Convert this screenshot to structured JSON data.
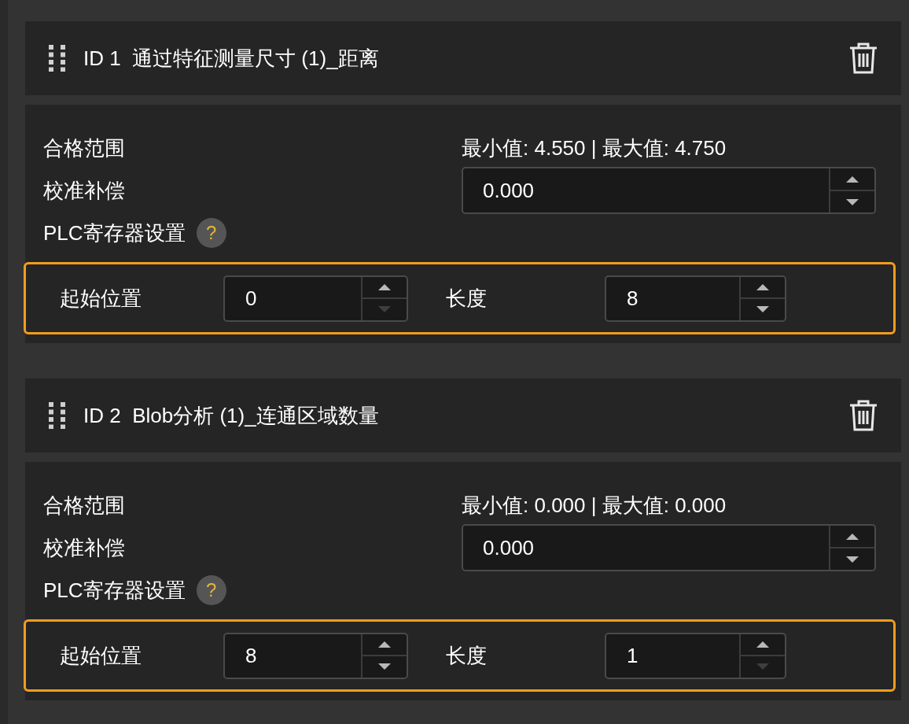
{
  "items": [
    {
      "id_label": "ID 1",
      "name": "通过特征测量尺寸 (1)_距离",
      "range_label": "合格范围",
      "range_value": "最小值: 4.550 | 最大值: 4.750",
      "calibration_label": "校准补偿",
      "calibration": {
        "value": "0.000",
        "up_disabled": false,
        "down_disabled": false
      },
      "plc_label": "PLC寄存器设置",
      "help": "?",
      "plc_highlighted": true,
      "start_label": "起始位置",
      "start": {
        "value": "0",
        "up_disabled": false,
        "down_disabled": true
      },
      "length_label": "长度",
      "length": {
        "value": "8",
        "up_disabled": false,
        "down_disabled": false
      }
    },
    {
      "id_label": "ID 2",
      "name": "Blob分析 (1)_连通区域数量",
      "range_label": "合格范围",
      "range_value": "最小值: 0.000 | 最大值: 0.000",
      "calibration_label": "校准补偿",
      "calibration": {
        "value": "0.000",
        "up_disabled": false,
        "down_disabled": false
      },
      "plc_label": "PLC寄存器设置",
      "help": "?",
      "plc_highlighted": true,
      "start_label": "起始位置",
      "start": {
        "value": "8",
        "up_disabled": false,
        "down_disabled": false
      },
      "length_label": "长度",
      "length": {
        "value": "1",
        "up_disabled": false,
        "down_disabled": true
      }
    }
  ]
}
